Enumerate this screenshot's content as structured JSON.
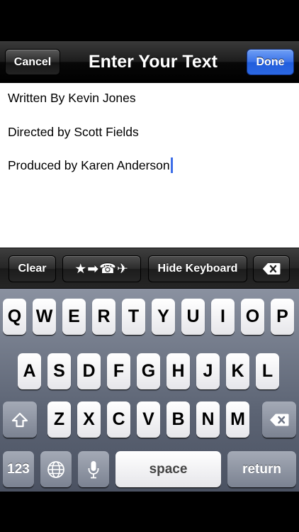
{
  "nav": {
    "cancel_label": "Cancel",
    "title": "Enter Your Text",
    "done_label": "Done"
  },
  "editor": {
    "lines": [
      "Written By Kevin Jones",
      "Directed by Scott Fields",
      "Produced by Karen Anderson"
    ]
  },
  "accessory": {
    "clear_label": "Clear",
    "symbols_label": "★➡☎✈",
    "hide_label": "Hide Keyboard"
  },
  "keyboard": {
    "row1": [
      "Q",
      "W",
      "E",
      "R",
      "T",
      "Y",
      "U",
      "I",
      "O",
      "P"
    ],
    "row2": [
      "A",
      "S",
      "D",
      "F",
      "G",
      "H",
      "J",
      "K",
      "L"
    ],
    "row3": [
      "Z",
      "X",
      "C",
      "V",
      "B",
      "N",
      "M"
    ],
    "num_label": "123",
    "space_label": "space",
    "return_label": "return"
  },
  "colors": {
    "done_blue": "#2c68e2",
    "caret": "#3d6ee8"
  }
}
